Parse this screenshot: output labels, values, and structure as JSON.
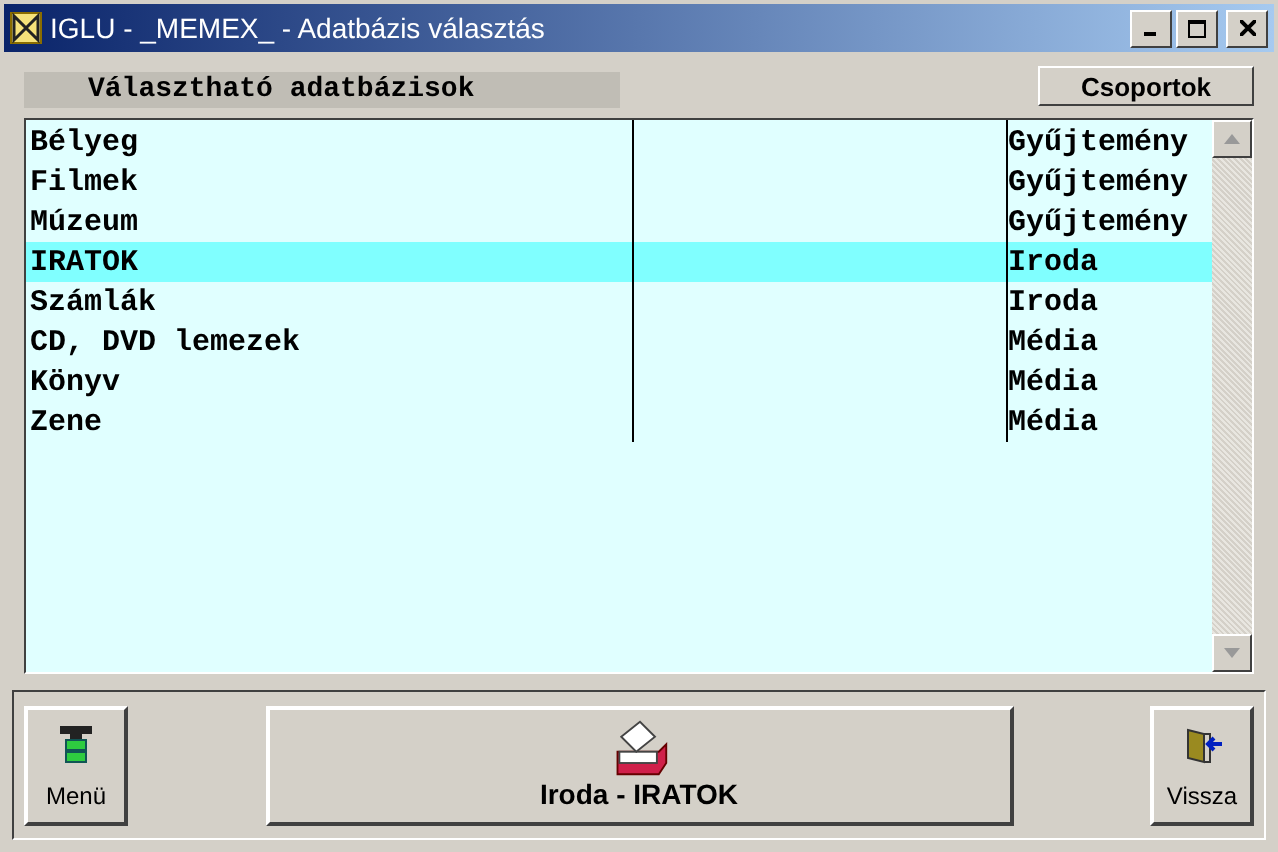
{
  "window": {
    "title": "IGLU - _MEMEX_ - Adatbázis választás"
  },
  "list_header": "Választható adatbázisok",
  "groups_button": "Csoportok",
  "rows": [
    {
      "name": "Bélyeg",
      "group": "Gyűjtemény",
      "selected": false
    },
    {
      "name": "Filmek",
      "group": "Gyűjtemény",
      "selected": false
    },
    {
      "name": "Múzeum",
      "group": "Gyűjtemény",
      "selected": false
    },
    {
      "name": "IRATOK",
      "group": "Iroda",
      "selected": true
    },
    {
      "name": "Számlák",
      "group": "Iroda",
      "selected": false
    },
    {
      "name": "CD, DVD lemezek",
      "group": "Média",
      "selected": false
    },
    {
      "name": "Könyv",
      "group": "Média",
      "selected": false
    },
    {
      "name": "Zene",
      "group": "Média",
      "selected": false
    }
  ],
  "buttons": {
    "menu": "Menü",
    "current": "Iroda - IRATOK",
    "back": "Vissza"
  }
}
